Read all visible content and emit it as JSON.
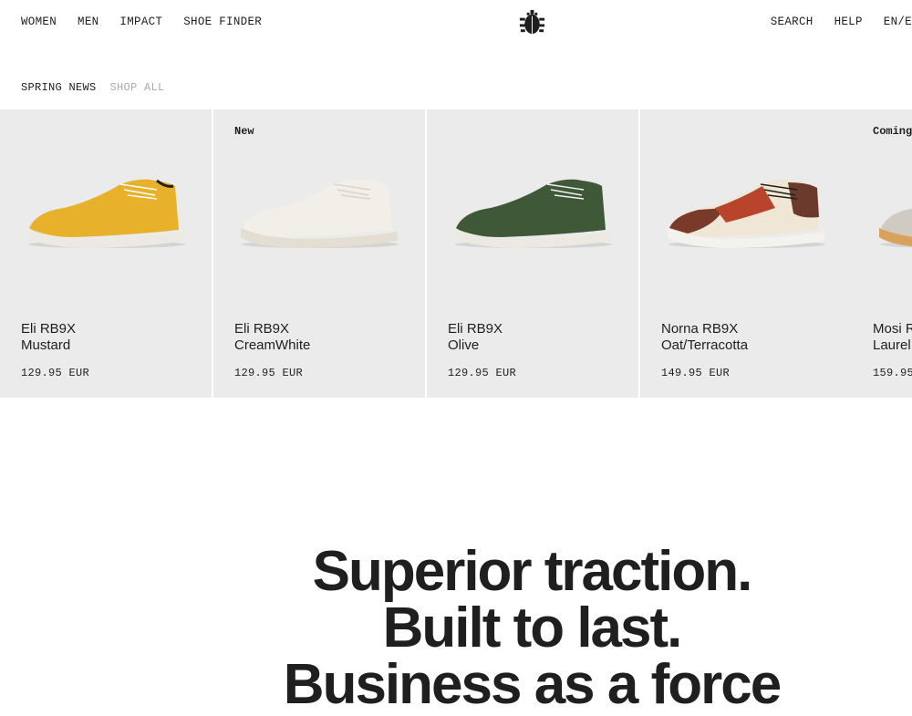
{
  "header": {
    "nav_left": [
      "WOMEN",
      "MEN",
      "IMPACT",
      "SHOE FINDER"
    ],
    "nav_right": [
      "SEARCH",
      "HELP",
      "EN/E"
    ],
    "logo_icon": "beetle-logo-icon"
  },
  "subnav": {
    "active": "SPRING NEWS",
    "shop_all": "SHOP ALL"
  },
  "products": [
    {
      "badge": "",
      "model": "Eli RB9X",
      "color": "Mustard",
      "price": "129.95 EUR",
      "upper": "#e8b12c"
    },
    {
      "badge": "New",
      "model": "Eli RB9X",
      "color": "CreamWhite",
      "price": "129.95 EUR",
      "upper": "#f2efe8"
    },
    {
      "badge": "",
      "model": "Eli RB9X",
      "color": "Olive",
      "price": "129.95 EUR",
      "upper": "#3f5838"
    },
    {
      "badge": "",
      "model": "Norna RB9X",
      "color": "Oat/Terracotta",
      "price": "149.95 EUR",
      "upper": "#b8452b"
    },
    {
      "badge": "Coming",
      "model": "Mosi R",
      "color": "Laurel",
      "price": "159.95",
      "upper": "#cfcbc2"
    }
  ],
  "hero": {
    "line1": "Superior traction.",
    "line2": "Built to last.",
    "line3": "Business as a force"
  }
}
